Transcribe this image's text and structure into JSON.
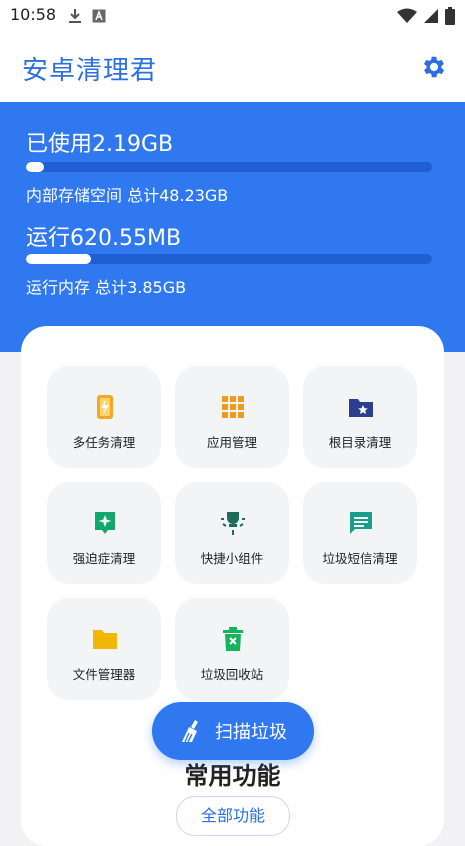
{
  "status": {
    "time": "10:58"
  },
  "app": {
    "title": "安卓清理君"
  },
  "colors": {
    "primary": "#2f78f0",
    "title": "#2b6fe0"
  },
  "storage": {
    "title": "已使用2.19GB",
    "subtitle": "内部存储空间 总计48.23GB",
    "progress": 0.045
  },
  "memory": {
    "title": "运行620.55MB",
    "subtitle": "运行内存 总计3.85GB",
    "progress": 0.16
  },
  "tools": [
    {
      "label": "多任务清理",
      "icon": "phone-bolt-icon"
    },
    {
      "label": "应用管理",
      "icon": "apps-grid-icon"
    },
    {
      "label": "根目录清理",
      "icon": "folder-star-icon"
    },
    {
      "label": "强迫症清理",
      "icon": "sparkle-badge-icon"
    },
    {
      "label": "快捷小组件",
      "icon": "lightbulb-icon"
    },
    {
      "label": "垃圾短信清理",
      "icon": "message-icon"
    },
    {
      "label": "文件管理器",
      "icon": "folder-icon"
    },
    {
      "label": "垃圾回收站",
      "icon": "trash-icon"
    }
  ],
  "section": {
    "title": "常用功能",
    "all_label": "全部功能"
  },
  "scan": {
    "label": "扫描垃圾"
  }
}
